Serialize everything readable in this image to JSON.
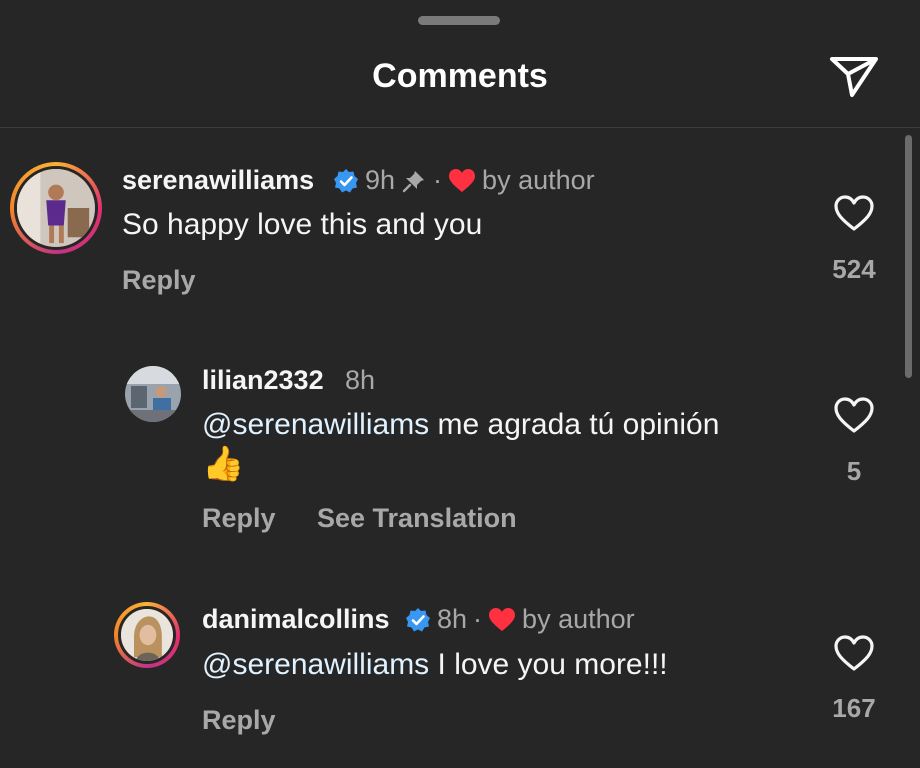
{
  "header": {
    "title": "Comments",
    "share_icon": "paper-plane-icon"
  },
  "colors": {
    "background": "#262626",
    "muted_text": "#a8a8a8",
    "verified_blue": "#3897f0",
    "heart_red": "#ff3040"
  },
  "comments": [
    {
      "username": "serenawilliams",
      "verified": true,
      "time": "9h",
      "pinned": true,
      "liked_by_author": "by author",
      "text": "So happy love this and you",
      "reply_label": "Reply",
      "likes": "524"
    },
    {
      "username": "lilian2332",
      "verified": false,
      "time": "8h",
      "mention": "@serenawilliams",
      "text": " me agrada tú opinión",
      "emoji": "👍",
      "reply_label": "Reply",
      "translate_label": "See Translation",
      "likes": "5"
    },
    {
      "username": "danimalcollins",
      "verified": true,
      "time": "8h",
      "liked_by_author": "by author",
      "mention": "@serenawilliams",
      "text": " I love you more!!!",
      "reply_label": "Reply",
      "likes": "167"
    }
  ]
}
